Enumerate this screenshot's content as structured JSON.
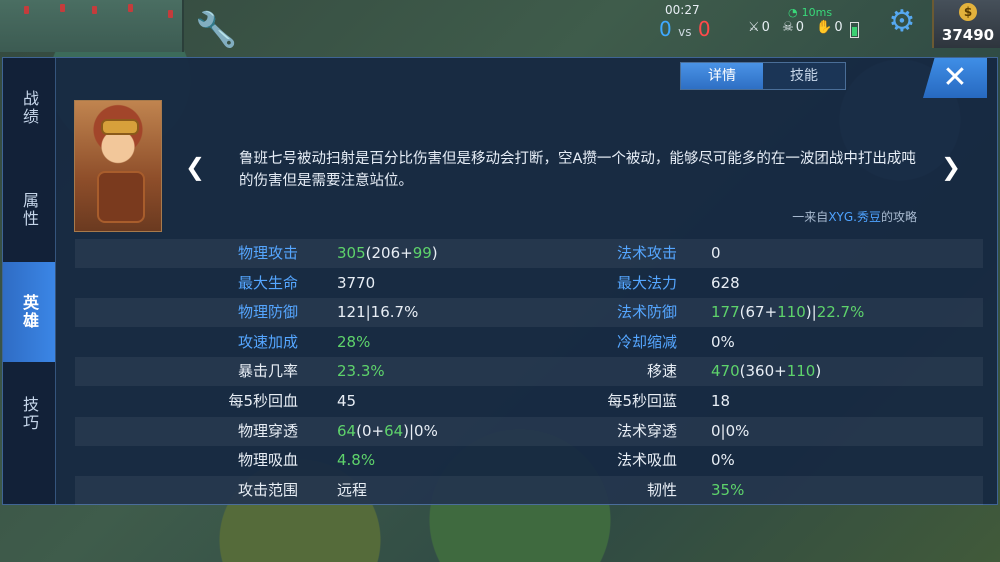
{
  "hud": {
    "timer": "00:27",
    "score_left": "0",
    "score_vs": "vs",
    "score_right": "0",
    "ping": "10ms",
    "kills": "0",
    "deaths": "0",
    "assists": "0",
    "gold": "37490",
    "gold_symbol": "$"
  },
  "side_tabs": [
    {
      "label": "战绩",
      "active": false
    },
    {
      "label": "属性",
      "active": false
    },
    {
      "label": "英雄",
      "active": true
    },
    {
      "label": "技巧",
      "active": false
    }
  ],
  "top_tabs": [
    {
      "label": "详情",
      "active": true
    },
    {
      "label": "技能",
      "active": false
    }
  ],
  "close_label": "✕",
  "tip": {
    "text": "鲁班七号被动扫射是百分比伤害但是移动会打断，空A攒一个被动，能够尽可能多的在一波团战中打出成吨的伤害但是需要注意站位。",
    "source_prefix": "一来自",
    "source_author": "XYG.秀豆",
    "source_suffix": "的攻略"
  },
  "stats": [
    {
      "left": {
        "label": "物理攻击",
        "label_color": "blue",
        "value": [
          {
            "t": "305",
            "c": "g"
          },
          {
            "t": "(206+",
            "c": "w"
          },
          {
            "t": "99",
            "c": "g"
          },
          {
            "t": ")",
            "c": "w"
          }
        ]
      },
      "right": {
        "label": "法术攻击",
        "label_color": "blue",
        "value": [
          {
            "t": "0",
            "c": "w"
          }
        ]
      }
    },
    {
      "left": {
        "label": "最大生命",
        "label_color": "blue",
        "value": [
          {
            "t": "3770",
            "c": "w"
          }
        ]
      },
      "right": {
        "label": "最大法力",
        "label_color": "blue",
        "value": [
          {
            "t": "628",
            "c": "w"
          }
        ]
      }
    },
    {
      "left": {
        "label": "物理防御",
        "label_color": "blue",
        "value": [
          {
            "t": "121|16.7%",
            "c": "w"
          }
        ]
      },
      "right": {
        "label": "法术防御",
        "label_color": "blue",
        "value": [
          {
            "t": "177",
            "c": "g"
          },
          {
            "t": "(67+",
            "c": "w"
          },
          {
            "t": "110",
            "c": "g"
          },
          {
            "t": ")|",
            "c": "w"
          },
          {
            "t": "22.7%",
            "c": "g"
          }
        ]
      }
    },
    {
      "left": {
        "label": "攻速加成",
        "label_color": "blue",
        "value": [
          {
            "t": "28%",
            "c": "g"
          }
        ]
      },
      "right": {
        "label": "冷却缩减",
        "label_color": "blue",
        "value": [
          {
            "t": "0%",
            "c": "w"
          }
        ]
      }
    },
    {
      "left": {
        "label": "暴击几率",
        "label_color": "white",
        "value": [
          {
            "t": "23.3%",
            "c": "g"
          }
        ]
      },
      "right": {
        "label": "移速",
        "label_color": "white",
        "value": [
          {
            "t": "470",
            "c": "g"
          },
          {
            "t": "(360+",
            "c": "w"
          },
          {
            "t": "110",
            "c": "g"
          },
          {
            "t": ")",
            "c": "w"
          }
        ]
      }
    },
    {
      "left": {
        "label": "每5秒回血",
        "label_color": "white",
        "value": [
          {
            "t": "45",
            "c": "w"
          }
        ]
      },
      "right": {
        "label": "每5秒回蓝",
        "label_color": "white",
        "value": [
          {
            "t": "18",
            "c": "w"
          }
        ]
      }
    },
    {
      "left": {
        "label": "物理穿透",
        "label_color": "white",
        "value": [
          {
            "t": "64",
            "c": "g"
          },
          {
            "t": "(0+",
            "c": "w"
          },
          {
            "t": "64",
            "c": "g"
          },
          {
            "t": ")|0%",
            "c": "w"
          }
        ]
      },
      "right": {
        "label": "法术穿透",
        "label_color": "white",
        "value": [
          {
            "t": "0|0%",
            "c": "w"
          }
        ]
      }
    },
    {
      "left": {
        "label": "物理吸血",
        "label_color": "white",
        "value": [
          {
            "t": "4.8%",
            "c": "g"
          }
        ]
      },
      "right": {
        "label": "法术吸血",
        "label_color": "white",
        "value": [
          {
            "t": "0%",
            "c": "w"
          }
        ]
      }
    },
    {
      "left": {
        "label": "攻击范围",
        "label_color": "white",
        "value": [
          {
            "t": "远程",
            "c": "w"
          }
        ]
      },
      "right": {
        "label": "韧性",
        "label_color": "white",
        "value": [
          {
            "t": "35%",
            "c": "g"
          }
        ]
      }
    }
  ]
}
